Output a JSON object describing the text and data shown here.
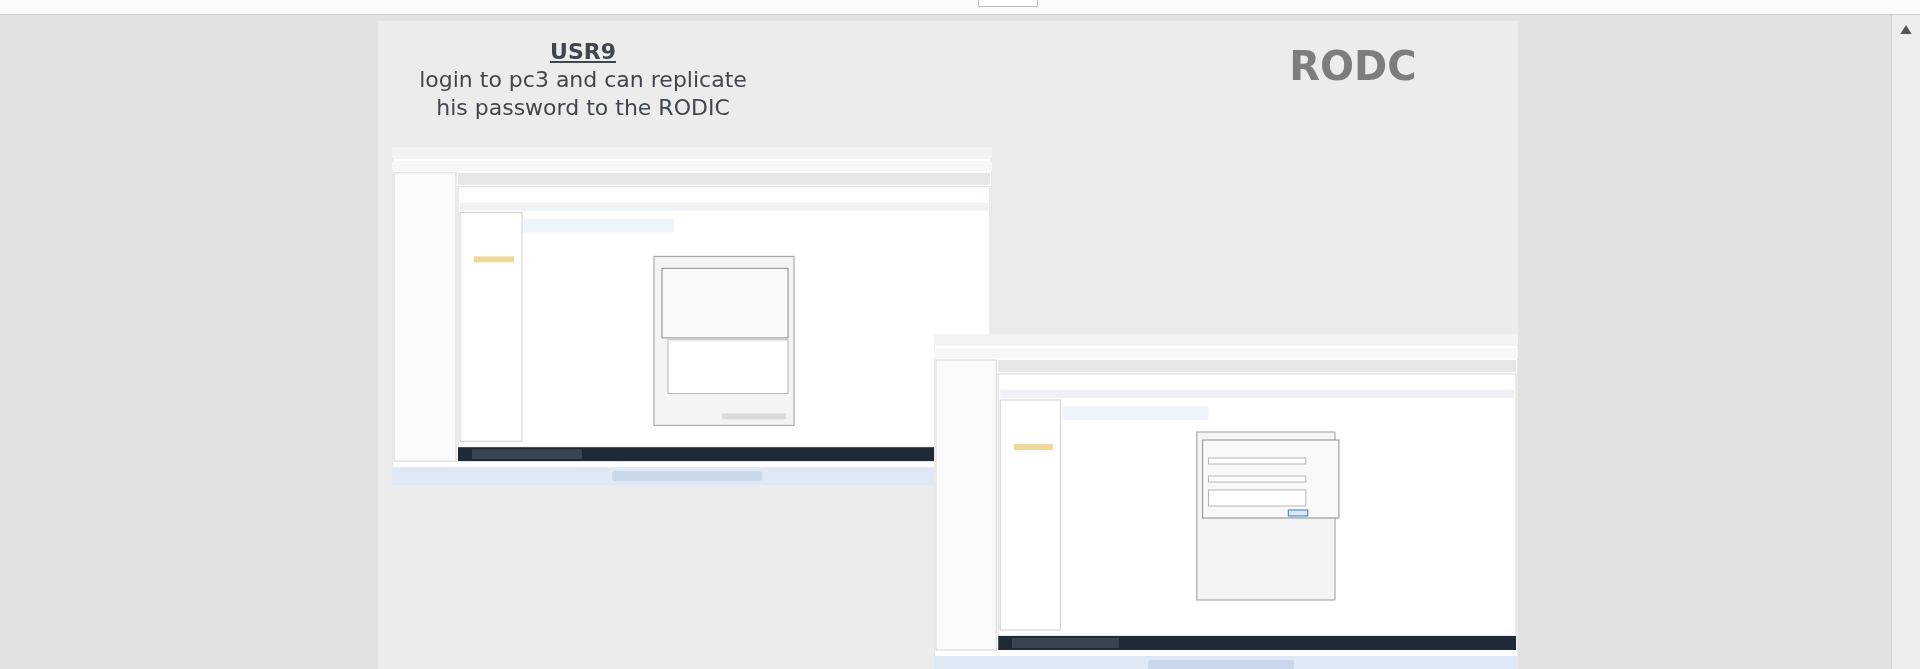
{
  "slide": {
    "title": "USR9",
    "subtitle": "login to pc3 and can replicate his password to the RODIC",
    "heading": "RODC",
    "screenshots": [
      {
        "kind": "password-policy-dialog"
      },
      {
        "kind": "select-users-dialog"
      }
    ]
  }
}
